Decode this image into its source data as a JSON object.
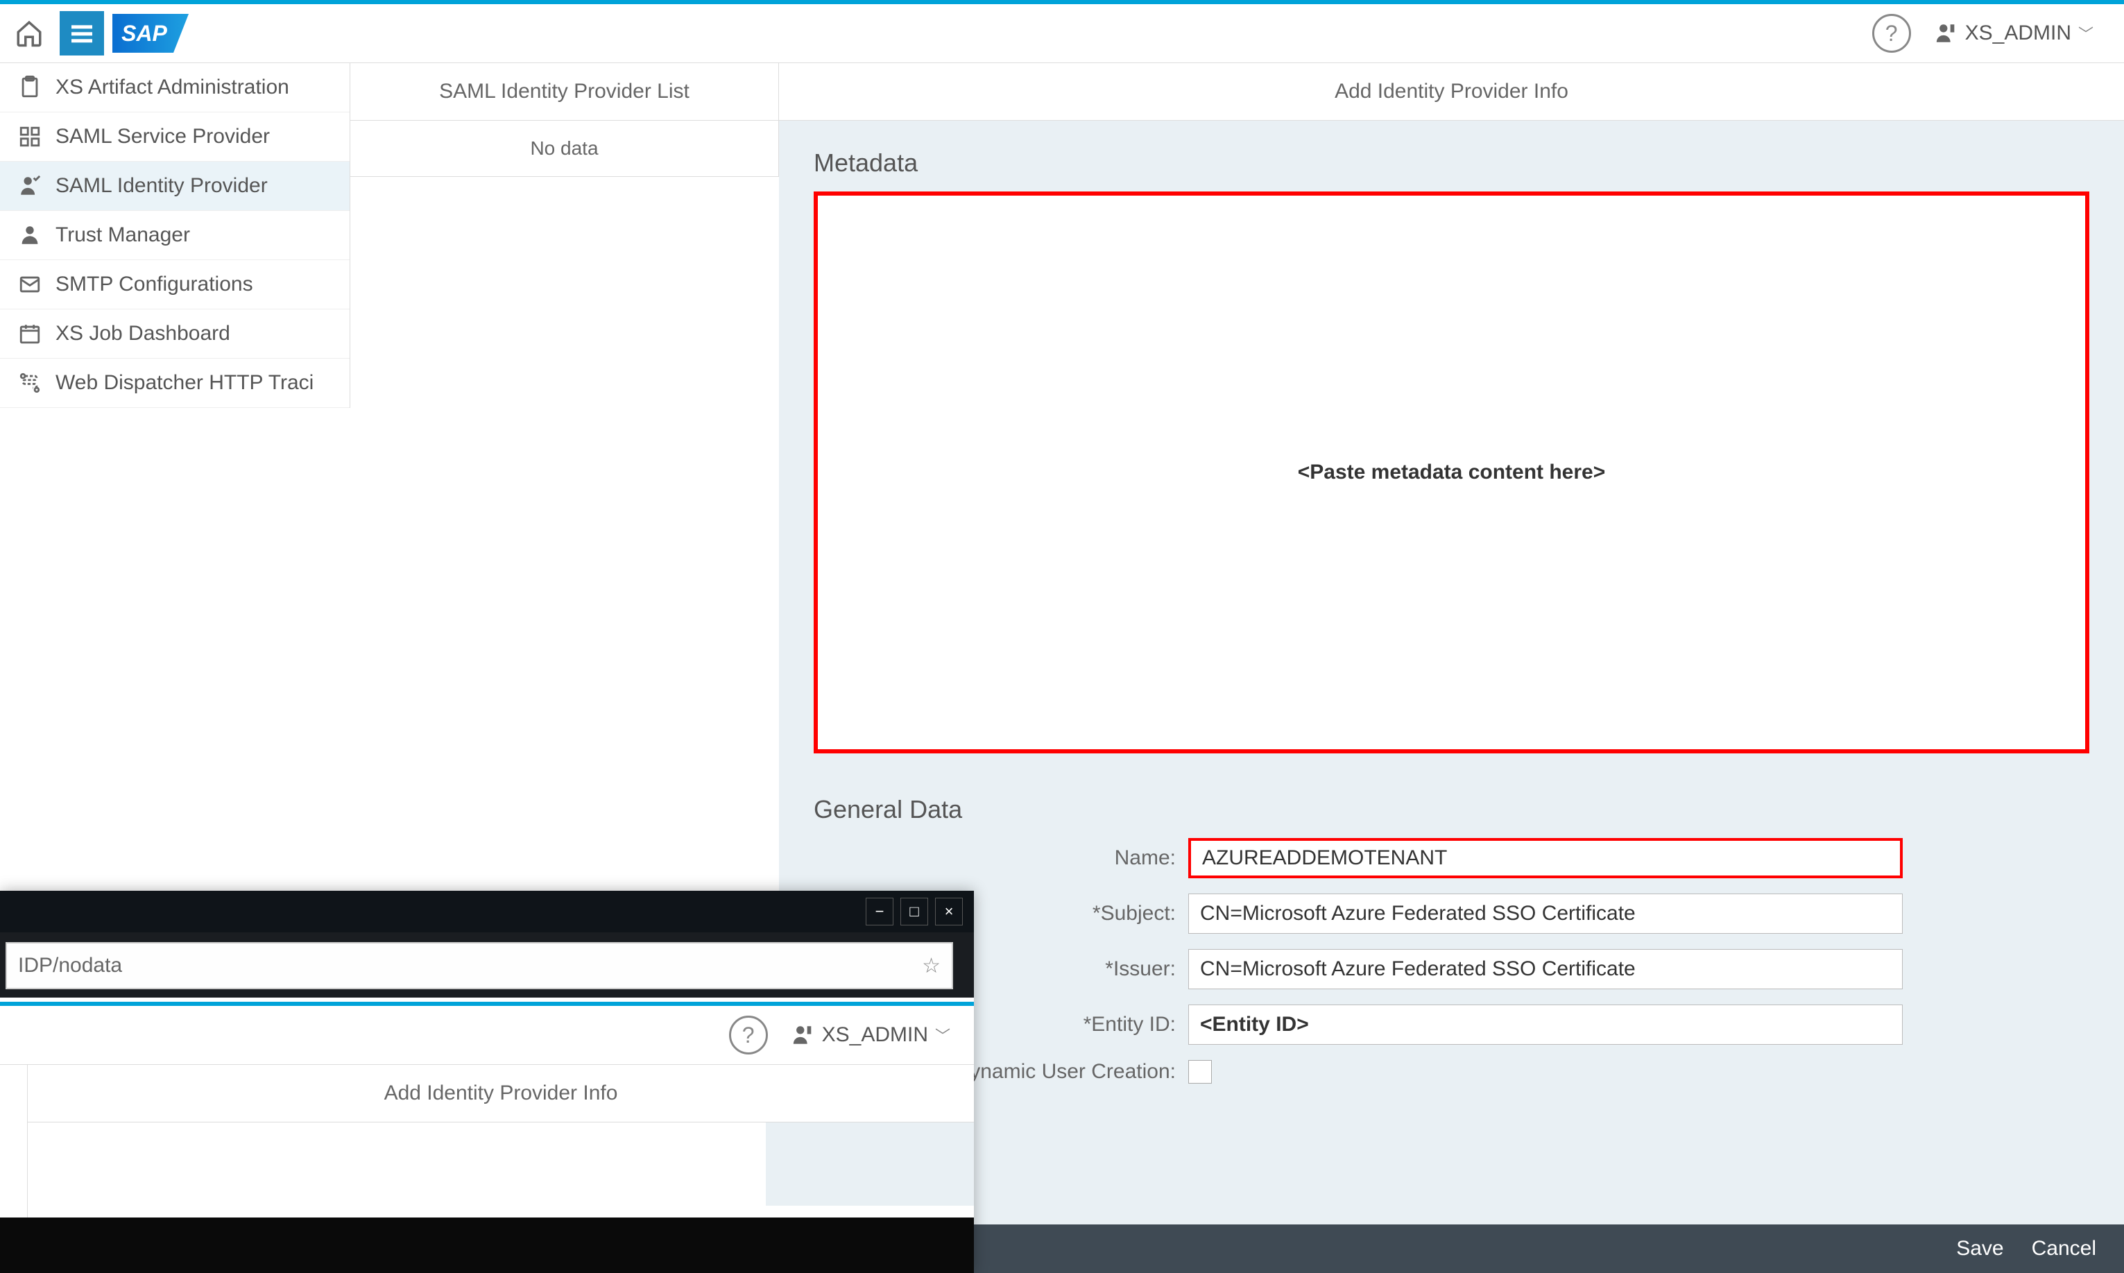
{
  "header": {
    "user": "XS_ADMIN",
    "logo": "SAP"
  },
  "sidebar": {
    "items": [
      {
        "label": "XS Artifact Administration"
      },
      {
        "label": "SAML Service Provider"
      },
      {
        "label": "SAML Identity Provider"
      },
      {
        "label": "Trust Manager"
      },
      {
        "label": "SMTP Configurations"
      },
      {
        "label": "XS Job Dashboard"
      },
      {
        "label": "Web Dispatcher HTTP Traci"
      }
    ]
  },
  "list": {
    "title": "SAML Identity Provider List",
    "empty": "No data"
  },
  "detail": {
    "title": "Add Identity Provider Info",
    "metadata_section": "Metadata",
    "metadata_placeholder": "<Paste metadata content here>",
    "general_section": "General Data",
    "labels": {
      "name": "Name:",
      "subject": "*Subject:",
      "issuer": "*Issuer:",
      "entity_id": "*Entity ID:",
      "dynamic_user": "Dynamic User Creation:"
    },
    "values": {
      "name": "AZUREADDEMOTENANT",
      "subject": "CN=Microsoft Azure Federated SSO Certificate",
      "issuer": "CN=Microsoft Azure Federated SSO Certificate",
      "entity_id": "<Entity ID>"
    }
  },
  "footer": {
    "save": "Save",
    "cancel": "Cancel"
  },
  "popup": {
    "url": "IDP/nodata",
    "user": "XS_ADMIN",
    "title": "Add Identity Provider Info"
  }
}
